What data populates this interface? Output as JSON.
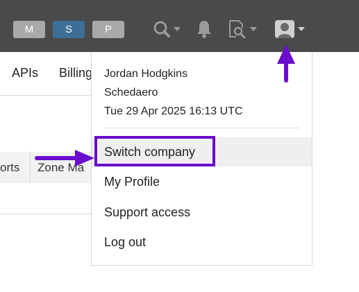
{
  "topbar": {
    "env_buttons": [
      {
        "label": "M"
      },
      {
        "label": "S"
      },
      {
        "label": "P"
      }
    ],
    "icons": [
      "search-icon",
      "bell-icon",
      "search-document-icon",
      "user-avatar-icon"
    ]
  },
  "subnav": {
    "items": [
      "APIs",
      "Billing"
    ]
  },
  "tabs": [
    "orts",
    "Zone Ma"
  ],
  "user_menu": {
    "name": "Jordan Hodgkins",
    "company": "Schedaero",
    "timestamp": "Tue 29 Apr 2025 16:13 UTC",
    "items": [
      "Switch company",
      "My Profile",
      "Support access",
      "Log out"
    ]
  },
  "colors": {
    "topbar": "#4a4a4a",
    "active_env": "#3d6e96",
    "annotation": "#6a0dcc"
  }
}
